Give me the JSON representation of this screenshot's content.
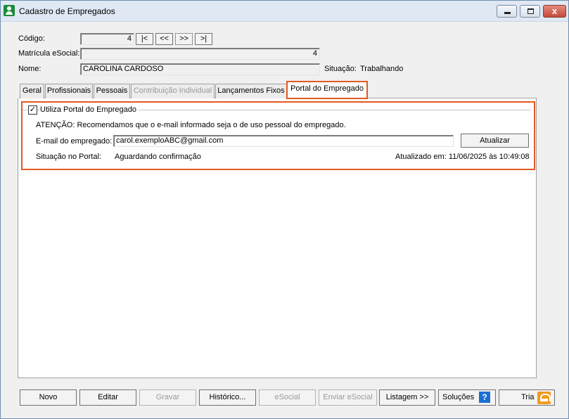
{
  "window": {
    "title": "Cadastro de Empregados",
    "close_glyph": "x"
  },
  "header": {
    "codigo_label": "Código:",
    "codigo_value": "4",
    "nav": {
      "first": "|<",
      "prev": "<<",
      "next": ">>",
      "last": ">|"
    },
    "matricula_label": "Matrícula eSocial:",
    "matricula_value": "4",
    "nome_label": "Nome:",
    "nome_value": "CAROLINA CARDOSO",
    "situacao_label": "Situação:",
    "situacao_value": "Trabalhando"
  },
  "tabs": [
    {
      "label": "Geral",
      "state": "normal"
    },
    {
      "label": "Profissionais",
      "state": "normal"
    },
    {
      "label": "Pessoais",
      "state": "normal"
    },
    {
      "label": "Contribuição Individual",
      "state": "disabled"
    },
    {
      "label": "Lançamentos Fixos",
      "state": "normal"
    },
    {
      "label": "Portal do Empregado",
      "state": "active"
    }
  ],
  "portal": {
    "checkbox_label": "Utiliza Portal do Empregado",
    "checked": true,
    "check_mark": "✓",
    "warning": "ATENÇÃO: Recomendamos que o e-mail informado seja o de uso pessoal do empregado.",
    "email_label": "E-mail do empregado:",
    "email_value": "carol.exemploABC@gmail.com",
    "update_button": "Atualizar",
    "portal_status_label": "Situação no Portal:",
    "portal_status_value": "Aguardando confirmação",
    "updated_at": "Atualizado em: 11/06/2025 às 10:49:08"
  },
  "footer": {
    "buttons": [
      {
        "label": "Novo",
        "state": "enabled"
      },
      {
        "label": "Editar",
        "state": "enabled"
      },
      {
        "label": "Gravar",
        "state": "disabled"
      },
      {
        "label": "Histórico...",
        "state": "enabled"
      },
      {
        "label": "eSocial",
        "state": "disabled"
      },
      {
        "label": "Enviar eSocial",
        "state": "disabled"
      },
      {
        "label": "Listagem >>",
        "state": "enabled"
      },
      {
        "label": "Soluções",
        "state": "enabled"
      },
      {
        "label": "Tria",
        "state": "enabled"
      }
    ],
    "help_glyph": "?"
  },
  "colors": {
    "highlight": "#e05a20",
    "help_icon": "#1a6fd1",
    "tria_icon": "#f39a1d",
    "app_icon": "#1c8a3a"
  }
}
